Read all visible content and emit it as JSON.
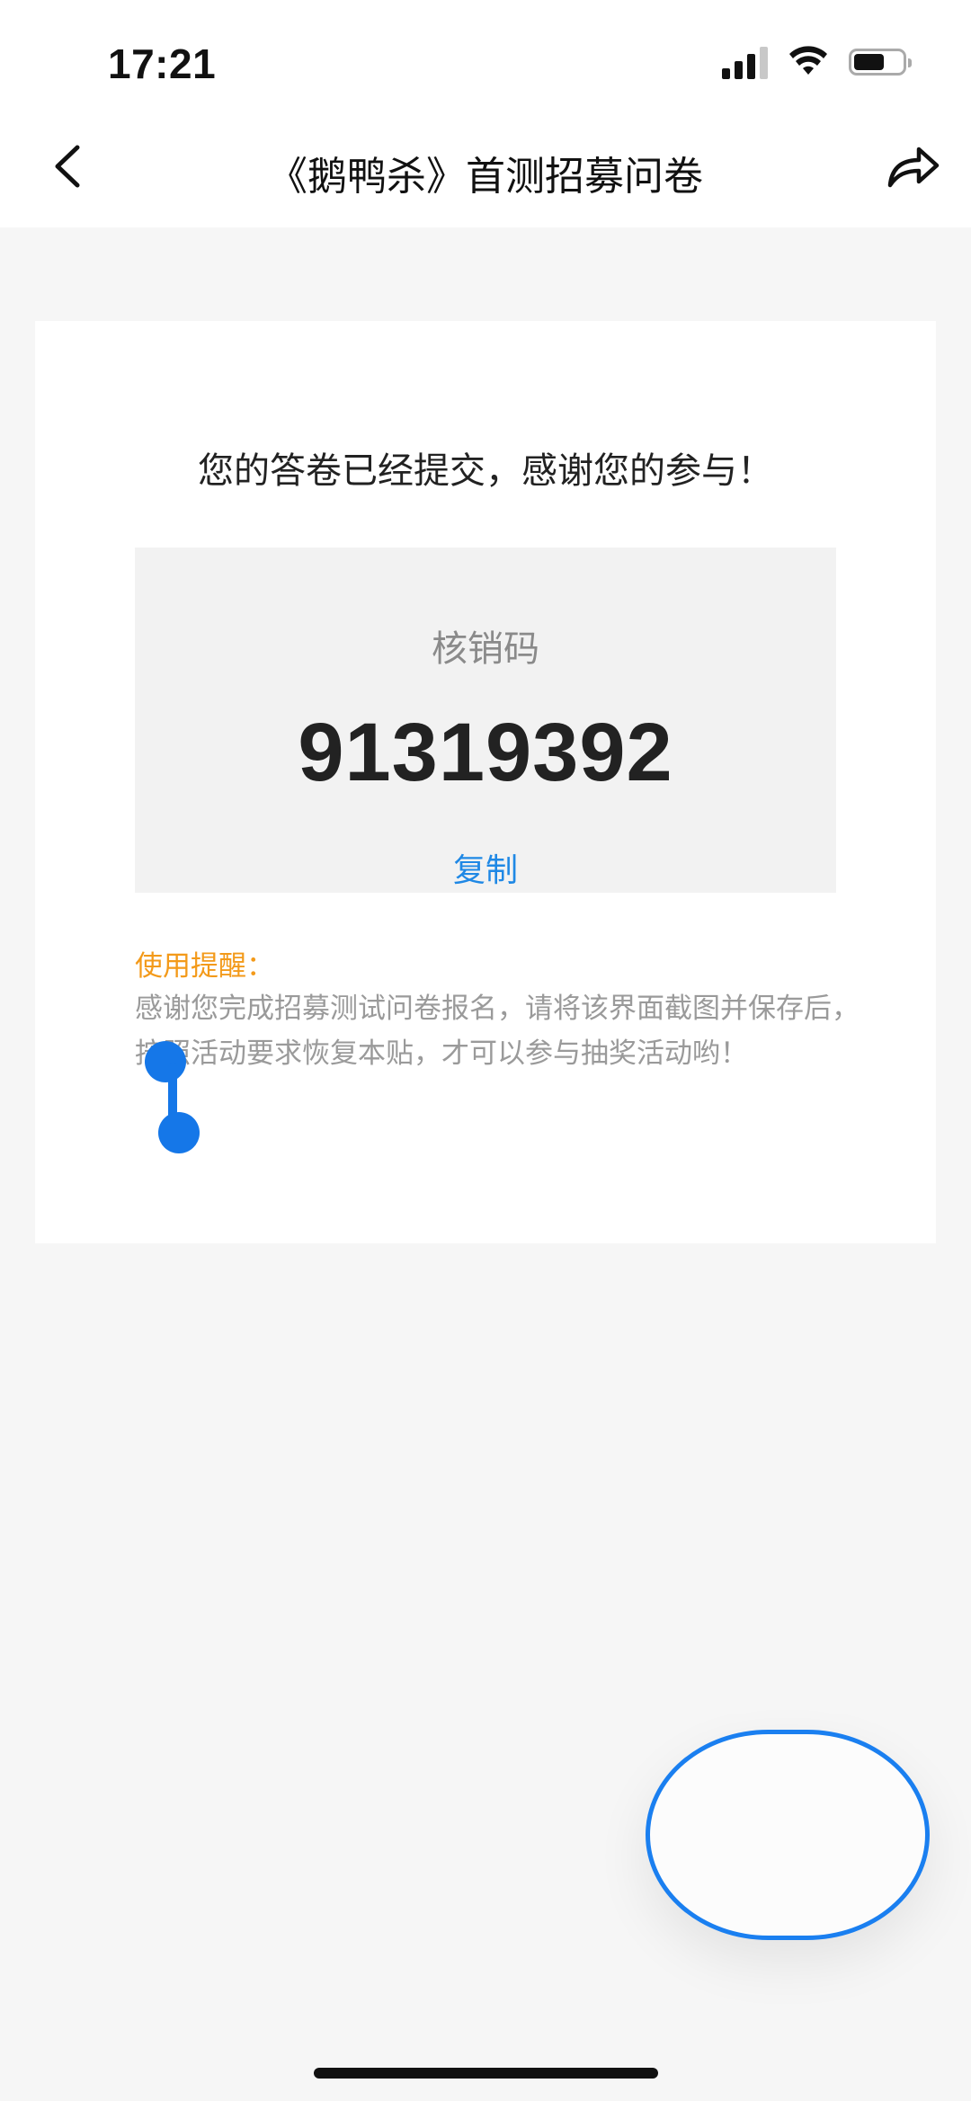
{
  "status_bar": {
    "time": "17:21",
    "icons": [
      "signal-icon",
      "wifi-icon",
      "battery-icon"
    ]
  },
  "nav": {
    "title": "《鹅鸭杀》首测招募问卷",
    "back_icon": "chevron-left-icon",
    "share_icon": "share-arrow-icon"
  },
  "card": {
    "headline": "您的答卷已经提交，感谢您的参与！",
    "code_label": "核销码",
    "code_value": "91319392",
    "copy_label": "复制",
    "tip_title": "使用提醒：",
    "tip_text": "感谢您完成招募测试问卷报名，请将该界面截图并保存后，按照活动要求恢复本贴，才可以参与抽奖活动哟！"
  },
  "colors": {
    "accent_blue": "#1f88e5",
    "tip_orange": "#f39a1a",
    "background": "#f6f6f6"
  }
}
